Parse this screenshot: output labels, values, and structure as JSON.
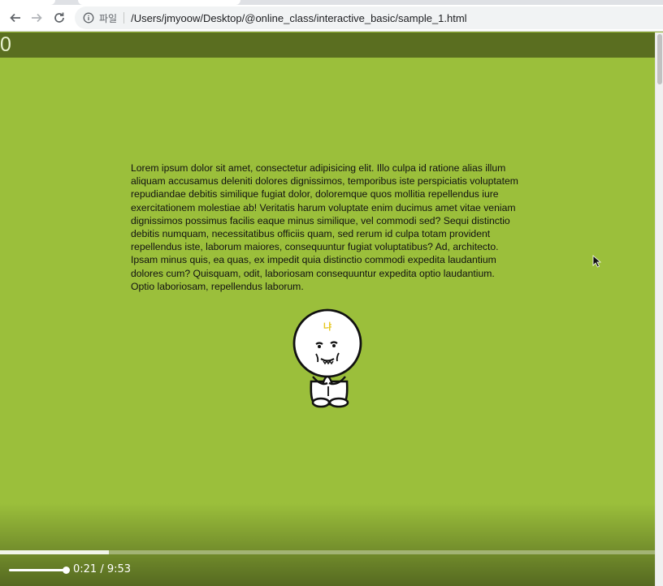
{
  "browser": {
    "address_scheme": "파일",
    "address_url": "/Users/jmyoow/Desktop/@online_class/interactive_basic/sample_1.html"
  },
  "page": {
    "counter": "0",
    "paragraph": "Lorem ipsum dolor sit amet, consectetur adipisicing elit. Illo culpa id ratione alias illum aliquam accusamus deleniti dolores dignissimos, temporibus iste perspiciatis voluptatem repudiandae debitis similique fugiat dolor, doloremque quos mollitia repellendus iure exercitationem molestiae ab! Veritatis harum voluptate enim ducimus amet vitae veniam dignissimos possimus facilis eaque minus similique, vel commodi sed? Sequi distinctio debitis numquam, necessitatibus officiis quam, sed rerum id culpa totam provident repellendus iste, laborum maiores, consequuntur fugiat voluptatibus? Ad, architecto. Ipsam minus quis, ea quas, ex impedit quia distinctio commodi expedita laudantium dolores cum? Quisquam, odit, laboriosam consequuntur expedita optio laudantium. Optio laboriosam, repellendus laborum.",
    "character_label": "냐",
    "background_color": "#9bbf3b",
    "header_color": "#5a6e20"
  },
  "video": {
    "current_time": "0:21",
    "separator": "/",
    "duration": "9:53",
    "progress_fraction": 0.166
  },
  "icons": [
    "back-arrow-icon",
    "forward-arrow-icon",
    "reload-icon",
    "info-icon",
    "mouse-cursor-icon"
  ]
}
